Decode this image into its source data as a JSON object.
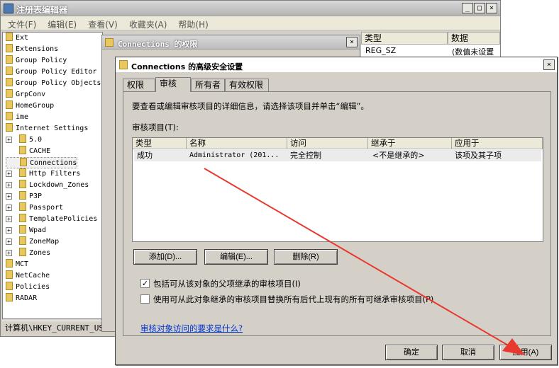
{
  "regedit": {
    "title": "注册表编辑器",
    "menu": [
      "文件(F)",
      "编辑(E)",
      "查看(V)",
      "收藏夹(A)",
      "帮助(H)"
    ],
    "tree": [
      {
        "label": "Ext",
        "indent": 0,
        "expander": ""
      },
      {
        "label": "Extensions",
        "indent": 0,
        "expander": ""
      },
      {
        "label": "Group Policy",
        "indent": 0,
        "expander": ""
      },
      {
        "label": "Group Policy Editor",
        "indent": 0,
        "expander": ""
      },
      {
        "label": "Group Policy Objects",
        "indent": 0,
        "expander": ""
      },
      {
        "label": "GrpConv",
        "indent": 0,
        "expander": ""
      },
      {
        "label": "HomeGroup",
        "indent": 0,
        "expander": ""
      },
      {
        "label": "ime",
        "indent": 0,
        "expander": ""
      },
      {
        "label": "Internet Settings",
        "indent": 0,
        "expander": ""
      },
      {
        "label": "5.0",
        "indent": 1,
        "expander": "+"
      },
      {
        "label": "CACHE",
        "indent": 1,
        "expander": ""
      },
      {
        "label": "Connections",
        "indent": 1,
        "expander": "",
        "selected": true
      },
      {
        "label": "Http Filters",
        "indent": 1,
        "expander": "+"
      },
      {
        "label": "Lockdown_Zones",
        "indent": 1,
        "expander": "+"
      },
      {
        "label": "P3P",
        "indent": 1,
        "expander": "+"
      },
      {
        "label": "Passport",
        "indent": 1,
        "expander": "+"
      },
      {
        "label": "TemplatePolicies",
        "indent": 1,
        "expander": "+"
      },
      {
        "label": "Wpad",
        "indent": 1,
        "expander": "+"
      },
      {
        "label": "ZoneMap",
        "indent": 1,
        "expander": "+"
      },
      {
        "label": "Zones",
        "indent": 1,
        "expander": "+"
      },
      {
        "label": "MCT",
        "indent": 0,
        "expander": ""
      },
      {
        "label": "NetCache",
        "indent": 0,
        "expander": ""
      },
      {
        "label": "Policies",
        "indent": 0,
        "expander": ""
      },
      {
        "label": "RADAR",
        "indent": 0,
        "expander": ""
      }
    ],
    "status": "计算机\\HKEY_CURRENT_US",
    "right_headers": [
      "类型",
      "数据"
    ],
    "right_row": [
      "REG_SZ",
      "(数值未设置"
    ]
  },
  "perm": {
    "title": "Connections 的权限"
  },
  "adv": {
    "title": "Connections 的高级安全设置",
    "tabs": [
      "权限",
      "审核",
      "所有者",
      "有效权限"
    ],
    "description": "要查看或编辑审核项目的详细信息，请选择该项目并单击“编辑”。",
    "list_label": "审核项目(T):",
    "columns": [
      "类型",
      "名称",
      "访问",
      "继承于",
      "应用于"
    ],
    "rows": [
      [
        "成功",
        "Administrator (201...",
        "完全控制",
        "<不是继承的>",
        "该项及其子项"
      ]
    ],
    "buttons": {
      "add": "添加(D)...",
      "edit": "编辑(E)...",
      "remove": "删除(R)"
    },
    "check1": "包括可从该对象的父项继承的审核项目(I)",
    "check2": "使用可从此对象继承的审核项目替换所有后代上现有的所有可继承审核项目(P)",
    "link": "审核对象访问的要求是什么?",
    "ok": "确定",
    "cancel": "取消",
    "apply": "应用(A)",
    "close": "×"
  },
  "colors": {
    "arrow": "#e8392f",
    "link": "#0033cc",
    "dialog_bg": "#d4d0c8"
  }
}
